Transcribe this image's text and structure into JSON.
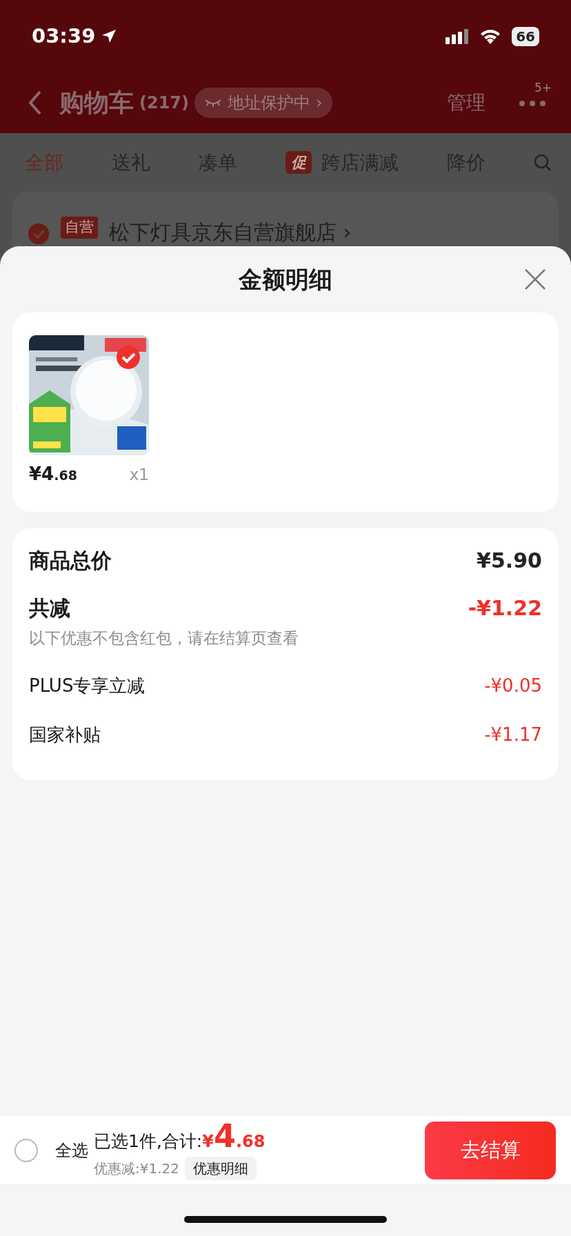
{
  "status_bar": {
    "time": "03:39",
    "battery": "66"
  },
  "header": {
    "title": "购物车",
    "count": "(217)",
    "address_pill": "地址保护中",
    "pill_chevron": "›",
    "manage": "管理",
    "more_badge": "5+"
  },
  "filter_tabs": [
    {
      "label": "全部",
      "selected": true
    },
    {
      "label": "送礼",
      "selected": false
    },
    {
      "label": "凑单",
      "selected": false
    },
    {
      "label": "跨店满减",
      "badge": "促",
      "selected": false
    },
    {
      "label": "降价",
      "selected": false
    }
  ],
  "store": {
    "checked": true,
    "tag": "自营",
    "name": "松下灯具京东自营旗舰店",
    "chevron": "›"
  },
  "sheet": {
    "title": "金额明细",
    "items": [
      {
        "checked": true,
        "price": "¥4.68",
        "quantity": "x1"
      }
    ],
    "summary": {
      "total_label": "商品总价",
      "total": "¥5.90",
      "discount_label": "共减",
      "discount": "-¥1.22",
      "note": "以下优惠不包含红包，请在结算页查看",
      "lines": [
        {
          "label": "PLUS专享立减",
          "amount": "-¥0.05"
        },
        {
          "label": "国家补贴",
          "amount": "-¥1.17"
        }
      ]
    }
  },
  "bottom_bar": {
    "select_all": {
      "label": "全选",
      "checked": false
    },
    "summary": "已选1件,合计:",
    "total": "¥4.68",
    "saving": "优惠减:¥1.22",
    "details_button": "优惠明细",
    "checkout_button": "去结算"
  }
}
